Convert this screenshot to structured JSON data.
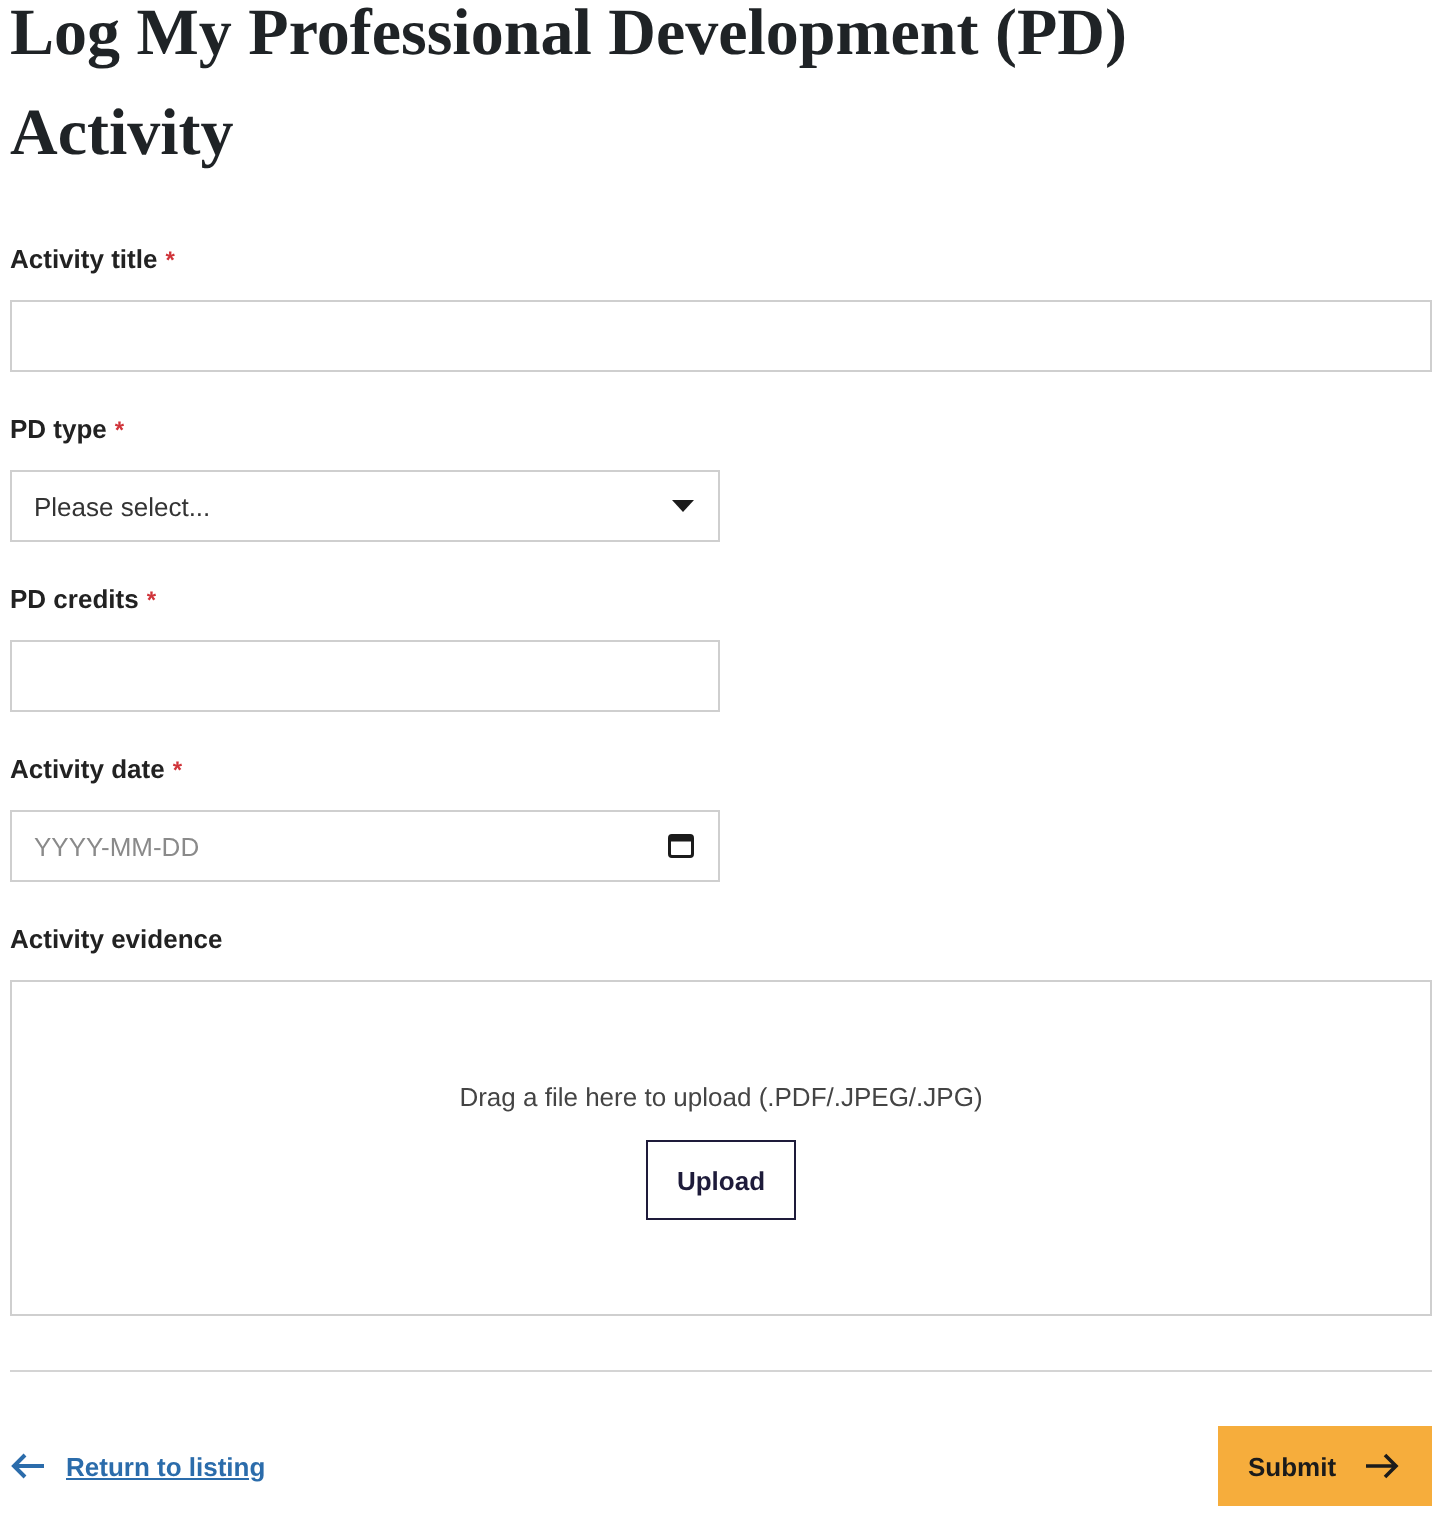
{
  "title": "Log My Professional Development (PD) Activity",
  "fields": [
    {
      "kind": "text",
      "label": "Activity title",
      "required_mark": "*"
    },
    {
      "kind": "select",
      "label": "PD type",
      "required_mark": "*",
      "placeholder": "Please select..."
    },
    {
      "kind": "text",
      "label": "PD credits",
      "required_mark": "*"
    },
    {
      "kind": "date",
      "label": "Activity date",
      "required_mark": "*",
      "placeholder": "YYYY-MM-DD"
    },
    {
      "kind": "file",
      "label": "Activity evidence",
      "hint": "Drag a file here to upload (.PDF/.JPEG/.JPG)",
      "button": "Upload"
    }
  ],
  "footer": {
    "back_link": "Return to listing",
    "submit": "Submit"
  }
}
